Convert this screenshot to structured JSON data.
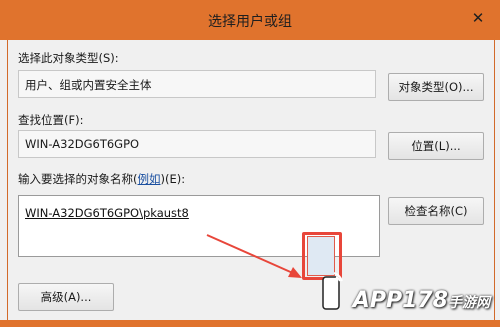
{
  "window": {
    "title": "选择用户或组",
    "close_glyph": "✕"
  },
  "object_type": {
    "label_prefix": "选择此对象类型",
    "label_key": "(S):",
    "value": "用户、组或内置安全主体",
    "button": "对象类型(O)..."
  },
  "location": {
    "label": "查找位置(F):",
    "value": "WIN-A32DG6T6GPO",
    "button": "位置(L)..."
  },
  "object_names": {
    "label_prefix": "输入要选择的对象名称(",
    "examples_link": "例如",
    "label_suffix": ")(E):",
    "value": "WIN-A32DG6T6GPO\\pkaust8",
    "button": "检查名称(C)"
  },
  "advanced_button": "高级(A)...",
  "watermark": {
    "text": "APP178",
    "sub": "手游网"
  },
  "colors": {
    "title_bar": "#e0732d",
    "highlight": "#e8463a"
  }
}
